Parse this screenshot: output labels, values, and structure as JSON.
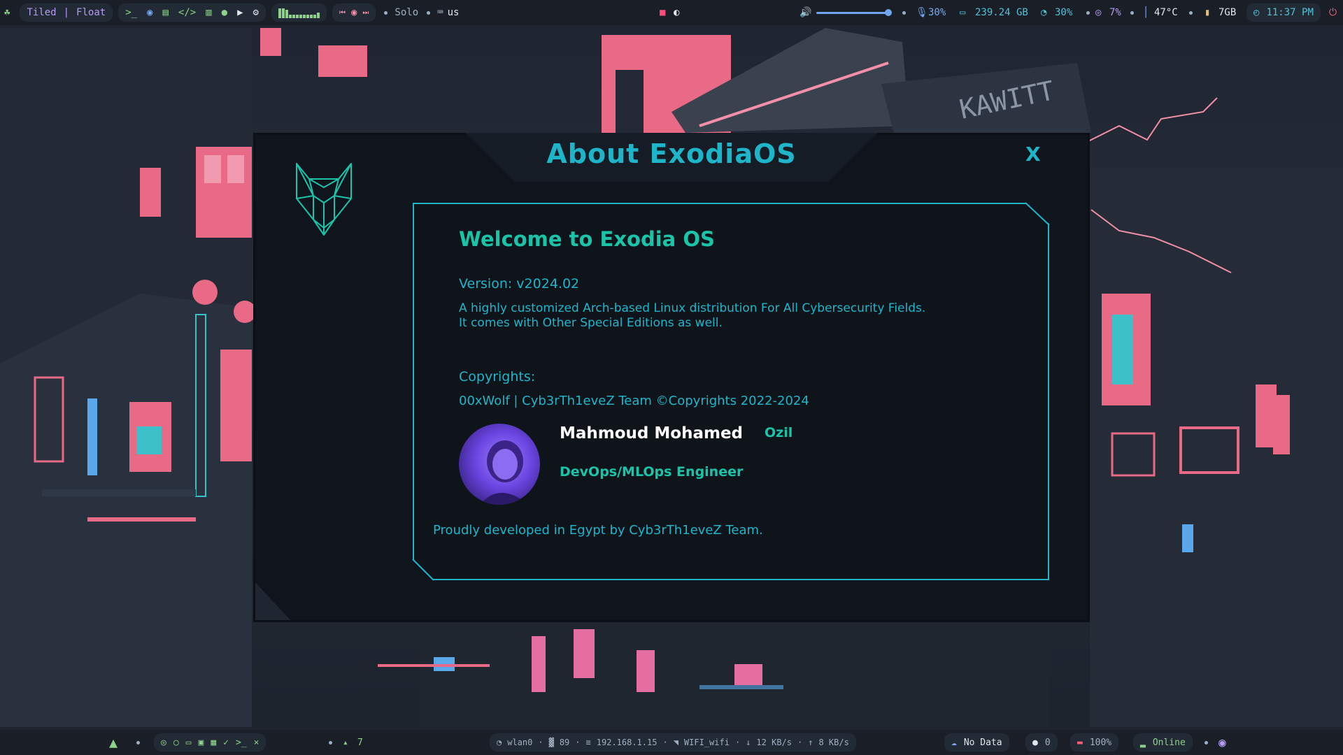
{
  "topbar": {
    "layout_tiled": "Tiled",
    "layout_sep": "|",
    "layout_float": "Float",
    "media_mode": "Solo",
    "keyboard_layout": "us",
    "volume_level": 1.0,
    "mic_percent": "30%",
    "disk_free": "239.24 GB",
    "cpu_percent": "30%",
    "gpu_percent": "7%",
    "temperature": "47°C",
    "memory": "7GB",
    "clock": "11:37 PM",
    "icons": [
      "leaf-icon",
      "terminal-icon",
      "firefox-icon",
      "folder-icon",
      "code-icon",
      "notes-icon",
      "chat-icon",
      "youtube-icon",
      "gear-icon",
      "prev-icon",
      "record-icon",
      "next-icon",
      "keyboard-icon",
      "jetbrains-icon",
      "discord-icon",
      "volume-icon",
      "mic-icon",
      "disk-icon",
      "cpu-icon",
      "gpu-icon",
      "thermometer-icon",
      "memory-icon",
      "clock-icon",
      "power-icon"
    ]
  },
  "about": {
    "title": "About ExodiaOS",
    "close_label": "X",
    "welcome": "Welcome to Exodia OS",
    "version": "Version: v2024.02",
    "desc_line1": "A highly customized Arch-based Linux distribution For All Cybersecurity Fields.",
    "desc_line2": "It comes with Other Special Editions as well.",
    "copyrights_heading": "Copyrights:",
    "copyrights_text": "00xWolf | Cyb3rTh1eveZ Team ©Copyrights 2022-2024",
    "author_name": "Mahmoud Mohamed",
    "author_nick": "Ozil",
    "author_role": "DevOps/MLOps Engineer",
    "footer": "Proudly developed in Egypt by Cyb3rTh1eveZ Team."
  },
  "bottombar": {
    "updates": "7",
    "wifi_iface": "wlan0",
    "signal": "89",
    "ip": "192.168.1.15",
    "ssid": "WIFI_wifi",
    "download": "12 KB/s",
    "upload": "8 KB/s",
    "weather": "No Data",
    "github": "0",
    "battery": "100%",
    "net_status": "Online",
    "app_icons": [
      "arch-launcher-icon",
      "chrome-icon",
      "whatsapp-icon",
      "monitor-icon",
      "discord-icon",
      "editor-icon",
      "terminal-icon",
      "vscode-icon"
    ]
  },
  "colors": {
    "accent": "#1fb5c9",
    "heading": "#19c4a9",
    "panel_bg": "#0f141b",
    "bar_bg": "#1a1f27"
  }
}
